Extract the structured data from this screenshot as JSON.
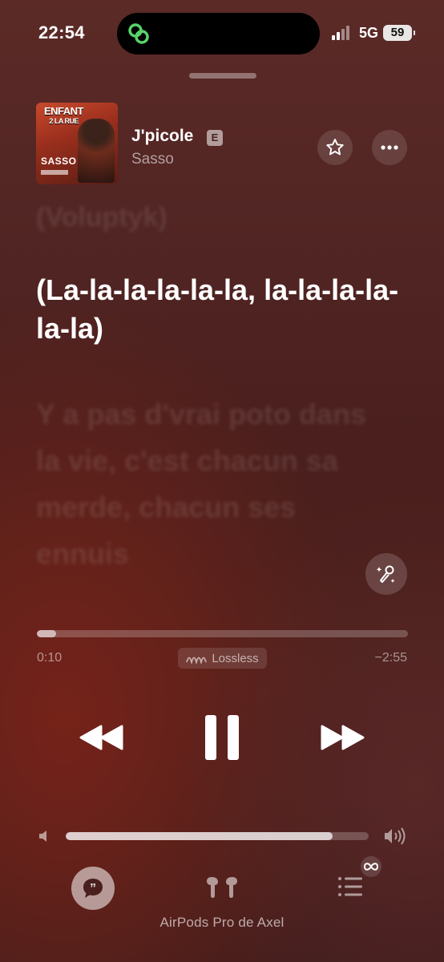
{
  "status_bar": {
    "time": "22:54",
    "network": "5G",
    "battery": "59",
    "island_icon": "link-activity-icon"
  },
  "now_playing": {
    "artwork": {
      "title_line1": "ENFANT",
      "title_line2": "2 LA RUE",
      "artist": "SASSO"
    },
    "title": "J'picole",
    "explicit_badge": "E",
    "artist": "Sasso"
  },
  "lyrics": {
    "previous": "(Voluptyk)",
    "current": "(La-la-la-la-la-la, la-la-la-la-la-la)",
    "next": "Y a pas d'vrai poto dans la vie, c'est chacun sa merde, chacun ses ennuis"
  },
  "playback": {
    "elapsed": "0:10",
    "remaining": "−2:55",
    "progress_fraction": 0.052,
    "quality_label": "Lossless"
  },
  "volume": {
    "level_fraction": 0.88
  },
  "output": {
    "device_label": "AirPods Pro de Axel"
  },
  "colors": {
    "background_top": "#5b2a27",
    "background_bottom": "#3f1d1c",
    "accent_green": "#58d36a"
  }
}
